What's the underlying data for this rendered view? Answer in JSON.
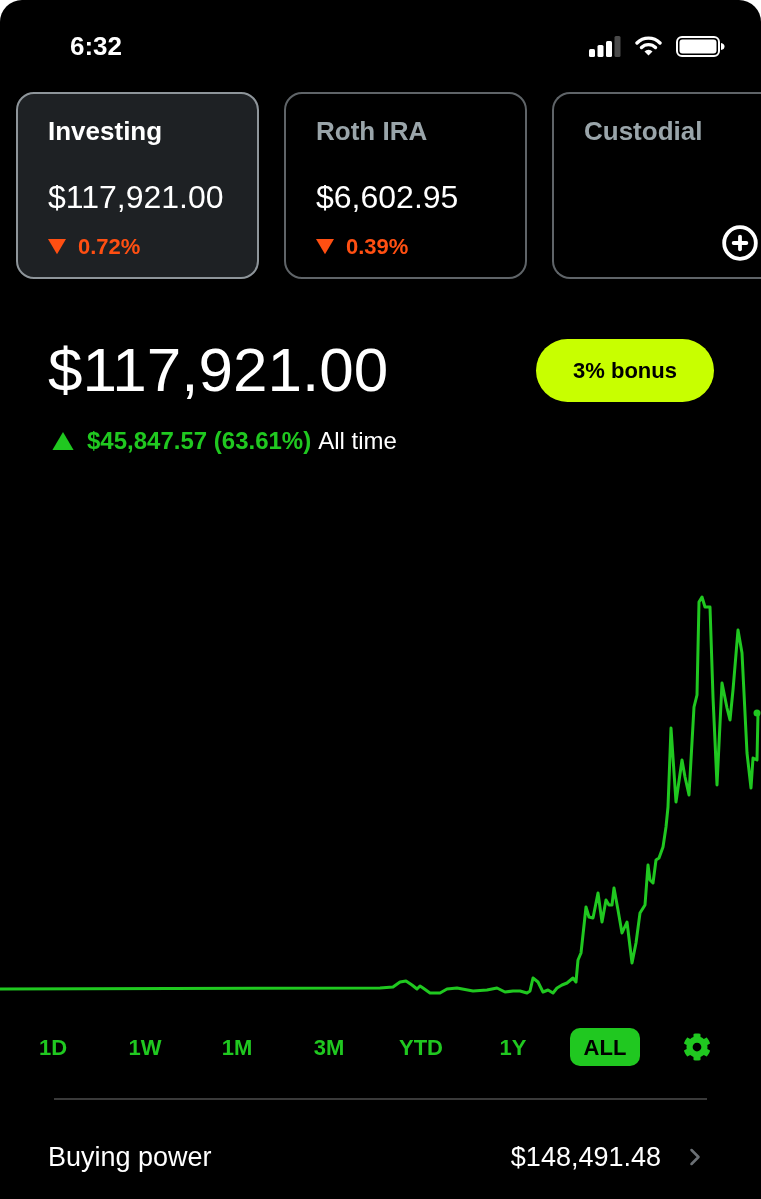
{
  "status_bar": {
    "time": "6:32"
  },
  "accounts": [
    {
      "kind": "account",
      "name": "Investing",
      "balance": "$117,921.00",
      "rising": false,
      "change": "0.72%",
      "selected": true
    },
    {
      "kind": "account",
      "name": "Roth IRA",
      "balance": "$6,602.95",
      "rising": false,
      "change": "0.39%",
      "selected": false
    },
    {
      "kind": "add",
      "name": "Custodial",
      "selected": false
    }
  ],
  "portfolio": {
    "value": "$117,921.00",
    "rising": true,
    "change": "$45,847.57 (63.61%)",
    "period": "All time",
    "bonus_button": "3% bonus"
  },
  "ranges": [
    {
      "label": "1D",
      "selected": false
    },
    {
      "label": "1W",
      "selected": false
    },
    {
      "label": "1M",
      "selected": false
    },
    {
      "label": "3M",
      "selected": false
    },
    {
      "label": "YTD",
      "selected": false
    },
    {
      "label": "1Y",
      "selected": false
    },
    {
      "label": "ALL",
      "selected": true
    }
  ],
  "buying_power": {
    "label": "Buying power",
    "value": "$148,491.48"
  }
}
